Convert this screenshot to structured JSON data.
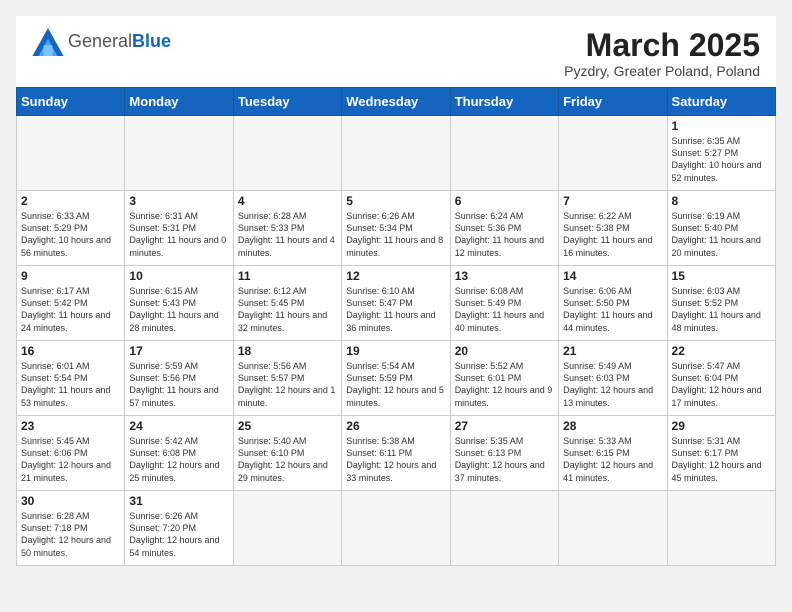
{
  "header": {
    "logo_general": "General",
    "logo_blue": "Blue",
    "month_title": "March 2025",
    "location": "Pyzdry, Greater Poland, Poland"
  },
  "days_of_week": [
    "Sunday",
    "Monday",
    "Tuesday",
    "Wednesday",
    "Thursday",
    "Friday",
    "Saturday"
  ],
  "weeks": [
    [
      {
        "day": "",
        "info": ""
      },
      {
        "day": "",
        "info": ""
      },
      {
        "day": "",
        "info": ""
      },
      {
        "day": "",
        "info": ""
      },
      {
        "day": "",
        "info": ""
      },
      {
        "day": "",
        "info": ""
      },
      {
        "day": "1",
        "info": "Sunrise: 6:35 AM\nSunset: 5:27 PM\nDaylight: 10 hours and 52 minutes."
      }
    ],
    [
      {
        "day": "2",
        "info": "Sunrise: 6:33 AM\nSunset: 5:29 PM\nDaylight: 10 hours and 56 minutes."
      },
      {
        "day": "3",
        "info": "Sunrise: 6:31 AM\nSunset: 5:31 PM\nDaylight: 11 hours and 0 minutes."
      },
      {
        "day": "4",
        "info": "Sunrise: 6:28 AM\nSunset: 5:33 PM\nDaylight: 11 hours and 4 minutes."
      },
      {
        "day": "5",
        "info": "Sunrise: 6:26 AM\nSunset: 5:34 PM\nDaylight: 11 hours and 8 minutes."
      },
      {
        "day": "6",
        "info": "Sunrise: 6:24 AM\nSunset: 5:36 PM\nDaylight: 11 hours and 12 minutes."
      },
      {
        "day": "7",
        "info": "Sunrise: 6:22 AM\nSunset: 5:38 PM\nDaylight: 11 hours and 16 minutes."
      },
      {
        "day": "8",
        "info": "Sunrise: 6:19 AM\nSunset: 5:40 PM\nDaylight: 11 hours and 20 minutes."
      }
    ],
    [
      {
        "day": "9",
        "info": "Sunrise: 6:17 AM\nSunset: 5:42 PM\nDaylight: 11 hours and 24 minutes."
      },
      {
        "day": "10",
        "info": "Sunrise: 6:15 AM\nSunset: 5:43 PM\nDaylight: 11 hours and 28 minutes."
      },
      {
        "day": "11",
        "info": "Sunrise: 6:12 AM\nSunset: 5:45 PM\nDaylight: 11 hours and 32 minutes."
      },
      {
        "day": "12",
        "info": "Sunrise: 6:10 AM\nSunset: 5:47 PM\nDaylight: 11 hours and 36 minutes."
      },
      {
        "day": "13",
        "info": "Sunrise: 6:08 AM\nSunset: 5:49 PM\nDaylight: 11 hours and 40 minutes."
      },
      {
        "day": "14",
        "info": "Sunrise: 6:06 AM\nSunset: 5:50 PM\nDaylight: 11 hours and 44 minutes."
      },
      {
        "day": "15",
        "info": "Sunrise: 6:03 AM\nSunset: 5:52 PM\nDaylight: 11 hours and 48 minutes."
      }
    ],
    [
      {
        "day": "16",
        "info": "Sunrise: 6:01 AM\nSunset: 5:54 PM\nDaylight: 11 hours and 53 minutes."
      },
      {
        "day": "17",
        "info": "Sunrise: 5:59 AM\nSunset: 5:56 PM\nDaylight: 11 hours and 57 minutes."
      },
      {
        "day": "18",
        "info": "Sunrise: 5:56 AM\nSunset: 5:57 PM\nDaylight: 12 hours and 1 minute."
      },
      {
        "day": "19",
        "info": "Sunrise: 5:54 AM\nSunset: 5:59 PM\nDaylight: 12 hours and 5 minutes."
      },
      {
        "day": "20",
        "info": "Sunrise: 5:52 AM\nSunset: 6:01 PM\nDaylight: 12 hours and 9 minutes."
      },
      {
        "day": "21",
        "info": "Sunrise: 5:49 AM\nSunset: 6:03 PM\nDaylight: 12 hours and 13 minutes."
      },
      {
        "day": "22",
        "info": "Sunrise: 5:47 AM\nSunset: 6:04 PM\nDaylight: 12 hours and 17 minutes."
      }
    ],
    [
      {
        "day": "23",
        "info": "Sunrise: 5:45 AM\nSunset: 6:06 PM\nDaylight: 12 hours and 21 minutes."
      },
      {
        "day": "24",
        "info": "Sunrise: 5:42 AM\nSunset: 6:08 PM\nDaylight: 12 hours and 25 minutes."
      },
      {
        "day": "25",
        "info": "Sunrise: 5:40 AM\nSunset: 6:10 PM\nDaylight: 12 hours and 29 minutes."
      },
      {
        "day": "26",
        "info": "Sunrise: 5:38 AM\nSunset: 6:11 PM\nDaylight: 12 hours and 33 minutes."
      },
      {
        "day": "27",
        "info": "Sunrise: 5:35 AM\nSunset: 6:13 PM\nDaylight: 12 hours and 37 minutes."
      },
      {
        "day": "28",
        "info": "Sunrise: 5:33 AM\nSunset: 6:15 PM\nDaylight: 12 hours and 41 minutes."
      },
      {
        "day": "29",
        "info": "Sunrise: 5:31 AM\nSunset: 6:17 PM\nDaylight: 12 hours and 45 minutes."
      }
    ],
    [
      {
        "day": "30",
        "info": "Sunrise: 6:28 AM\nSunset: 7:18 PM\nDaylight: 12 hours and 50 minutes."
      },
      {
        "day": "31",
        "info": "Sunrise: 6:26 AM\nSunset: 7:20 PM\nDaylight: 12 hours and 54 minutes."
      },
      {
        "day": "",
        "info": ""
      },
      {
        "day": "",
        "info": ""
      },
      {
        "day": "",
        "info": ""
      },
      {
        "day": "",
        "info": ""
      },
      {
        "day": "",
        "info": ""
      }
    ]
  ]
}
